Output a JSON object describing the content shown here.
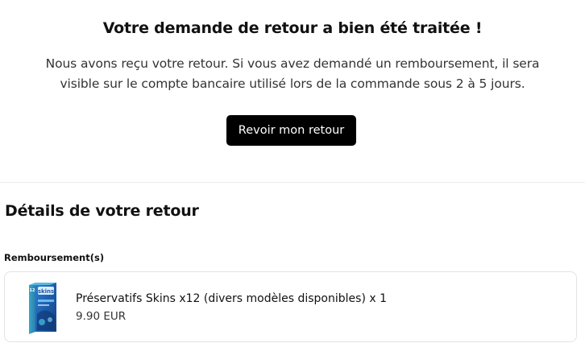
{
  "confirmation": {
    "title": "Votre demande de retour a bien été traitée !",
    "message_line1": "Nous avons reçu votre retour. Si vous avez demandé un remboursement, il sera",
    "message_line2": "visible sur le compte bancaire utilisé lors de la commande sous 2 à 5 jours.",
    "review_button_label": "Revoir mon retour"
  },
  "details": {
    "title": "Détails de votre retour",
    "section_label": "Remboursement(s)",
    "items": [
      {
        "name": "Préservatifs Skins x12 (divers modèles disponibles) x 1",
        "price": "9.90 EUR",
        "image_icon": "condom-box-product-image",
        "image_brand_text": "skins",
        "image_count_text": "12"
      }
    ]
  },
  "colors": {
    "button_bg": "#000000",
    "button_text": "#ffffff",
    "product_box_blue": "#1f5fb0",
    "product_box_teal": "#3aa6c9"
  }
}
